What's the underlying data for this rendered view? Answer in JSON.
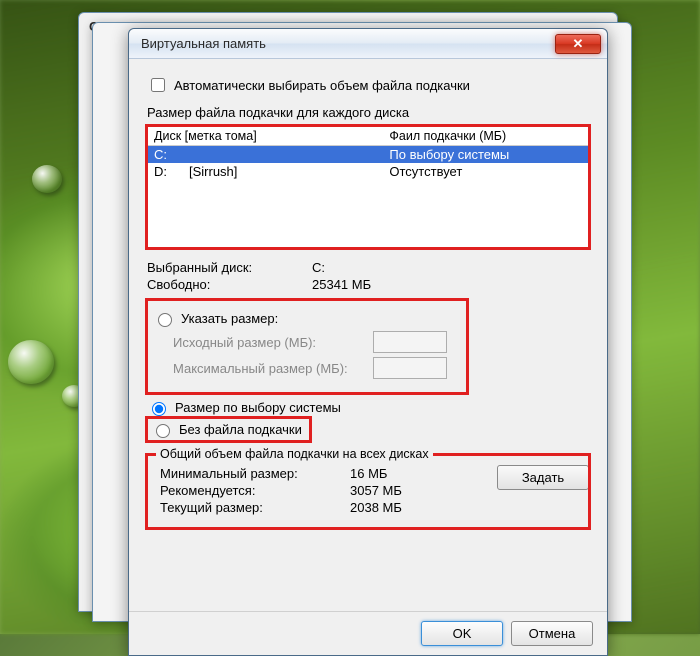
{
  "back_window_title": "Св",
  "dialog": {
    "title": "Виртуальная память",
    "auto_checkbox_label": "Автоматически выбирать объем файла подкачки",
    "section_label": "Размер файла подкачки для каждого диска",
    "drive_header": {
      "col1": "Диск [метка тома]",
      "col2": "Фаил подкачки (МБ)"
    },
    "drives": [
      {
        "letter": "C:",
        "label": "",
        "paging": "По выбору системы"
      },
      {
        "letter": "D:",
        "label": "[Sirrush]",
        "paging": "Отсутствует"
      }
    ],
    "selected": {
      "k": "Выбранный диск:",
      "v": "C:"
    },
    "free": {
      "k": "Свободно:",
      "v": "25341 МБ"
    },
    "radio_custom_label": "Указать размер:",
    "initial_label": "Исходный размер (МБ):",
    "max_label": "Максимальный размер (МБ):",
    "radio_system_label": "Размер по выбору системы",
    "radio_none_label": "Без файла подкачки",
    "set_button": "Задать",
    "totals": {
      "legend": "Общий объем файла подкачки на всех дисках",
      "min": {
        "k": "Минимальный размер:",
        "v": "16 МБ"
      },
      "rec": {
        "k": "Рекомендуется:",
        "v": "3057 МБ"
      },
      "cur": {
        "k": "Текущий размер:",
        "v": "2038 МБ"
      }
    },
    "ok": "OK",
    "cancel": "Отмена"
  }
}
